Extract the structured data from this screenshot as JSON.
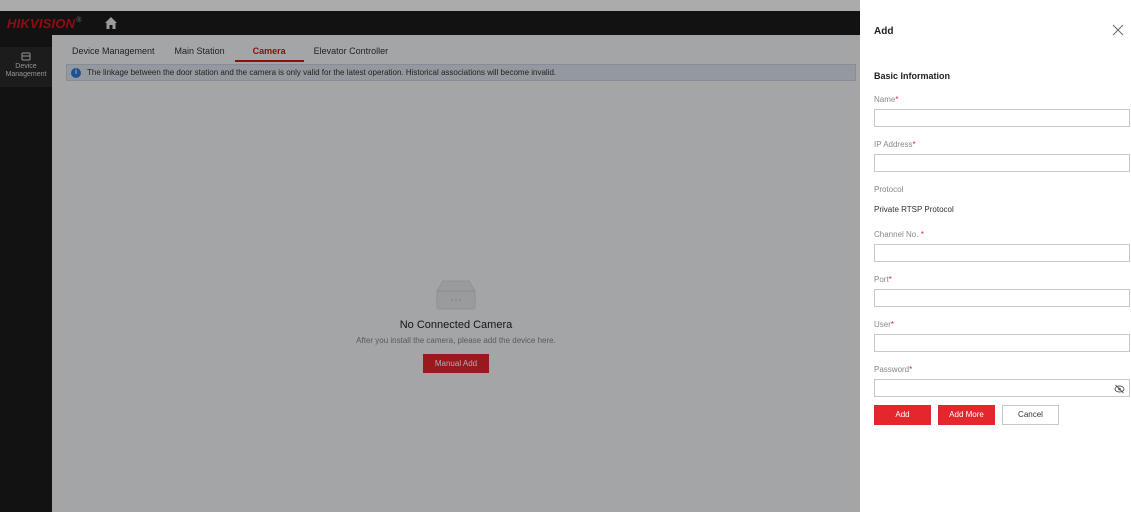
{
  "app": {
    "logo": "HIKVISION",
    "logo_mark": "®"
  },
  "nav": {
    "device_management": "Device Management"
  },
  "tabs": [
    {
      "label": "Device Management",
      "active": false
    },
    {
      "label": "Main Station",
      "active": false
    },
    {
      "label": "Camera",
      "active": true
    },
    {
      "label": "Elevator Controller",
      "active": false
    }
  ],
  "info_bar": {
    "text": "The linkage between the door station and the camera is only valid for the latest operation. Historical associations will become invalid."
  },
  "empty_state": {
    "title": "No Connected Camera",
    "subtitle": "After you install the camera, please add the device here.",
    "button": "Manual Add"
  },
  "panel": {
    "title": "Add",
    "section": "Basic Information",
    "fields": {
      "name": {
        "label": "Name",
        "value": ""
      },
      "ip_address": {
        "label": "IP Address",
        "value": ""
      },
      "protocol": {
        "label": "Protocol",
        "value": "Private RTSP Protocol"
      },
      "channel_no": {
        "label": "Channel No.",
        "value": ""
      },
      "port": {
        "label": "Port",
        "value": ""
      },
      "user": {
        "label": "User",
        "value": ""
      },
      "password": {
        "label": "Password",
        "value": ""
      }
    },
    "buttons": {
      "add": "Add",
      "add_more": "Add More",
      "cancel": "Cancel"
    }
  },
  "colors": {
    "brand_red": "#e4262d",
    "topbar": "#1b1b1b",
    "info_blue": "#2d79d6"
  },
  "icons": {
    "home": "home-icon",
    "device": "device-icon",
    "info": "info-icon",
    "empty": "empty-box-icon",
    "close": "close-icon",
    "eye": "eye-hidden-icon"
  }
}
